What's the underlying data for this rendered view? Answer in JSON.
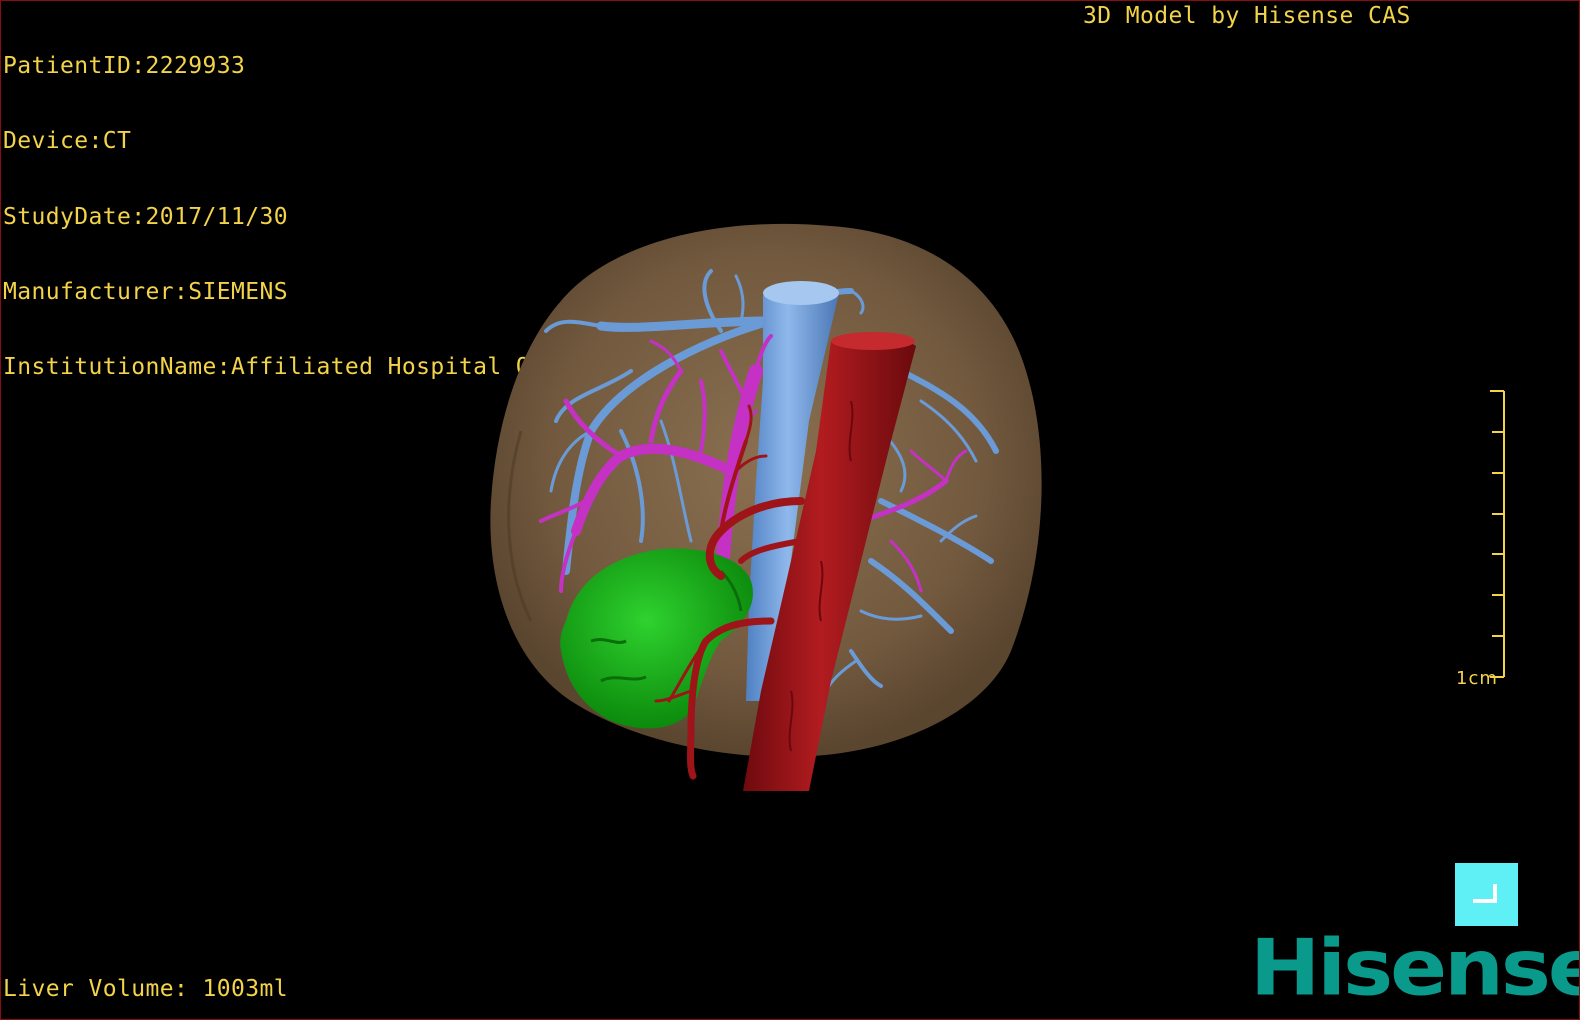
{
  "study_info": {
    "patient_id": "PatientID:2229933",
    "device": "Device:CT",
    "study_date": "StudyDate:2017/11/30",
    "manufacturer": "Manufacturer:SIEMENS",
    "institution": "InstitutionName:Affiliated Hospital Qingdao University-C"
  },
  "model_label": "3D Model by Hisense CAS",
  "liver_volume": "Liver Volume: 1003ml",
  "scale_bar": {
    "label": "1cm"
  },
  "brand": "Hisense",
  "colors": {
    "overlay_text": "#f2d34a",
    "liver": "#7a6246",
    "hepatic_vein": "#6b9bd6",
    "portal_vein": "#c431c4",
    "artery": "#9e1418",
    "tumor": "#14a814",
    "button": "#5ff0f6",
    "brand": "#0a9a8c",
    "border": "#8a0d14"
  }
}
